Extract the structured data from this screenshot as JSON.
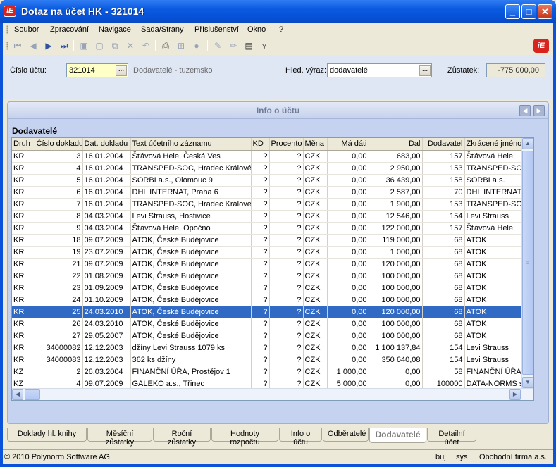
{
  "window": {
    "title": "Dotaz na účet HK - 321014",
    "app_icon_text": "iE",
    "min_label": "_",
    "max_label": "□",
    "close_label": "✕"
  },
  "menu": [
    "Soubor",
    "Zpracování",
    "Navigace",
    "Sada/Strany",
    "Příslušenství",
    "Okno",
    "?"
  ],
  "form": {
    "account_label": "Číslo účtu:",
    "account_value": "321014",
    "account_desc": "Dodavatelé - tuzemsko",
    "search_label": "Hled. výraz:",
    "search_value": "dodavatelé",
    "balance_label": "Zůstatek:",
    "balance_value": "-775 000,00",
    "ellipsis": "..."
  },
  "panel": {
    "title": "Info o účtu",
    "section": "Dodavatelé"
  },
  "table": {
    "columns": [
      "Druh",
      "Číslo dokladu",
      "Dat. dokladu",
      "Text účetního záznamu",
      "KD",
      "Procento",
      "Měna",
      "Má dáti",
      "Dal",
      "Dodavatel",
      "Zkrácené jméno"
    ],
    "rows": [
      [
        "KR",
        "3",
        "16.01.2004",
        "Šťávová Hele, Česká Ves",
        "?",
        "?",
        "CZK",
        "0,00",
        "683,00",
        "157",
        "Šťávová Hele"
      ],
      [
        "KR",
        "4",
        "16.01.2004",
        "TRANSPED-SOC, Hradec Králové",
        "?",
        "?",
        "CZK",
        "0,00",
        "2 950,00",
        "153",
        "TRANSPED-SOC"
      ],
      [
        "KR",
        "5",
        "16.01.2004",
        "SORBI a.s., Olomouc 9",
        "?",
        "?",
        "CZK",
        "0,00",
        "36 439,00",
        "158",
        "SORBI a.s."
      ],
      [
        "KR",
        "6",
        "16.01.2004",
        "DHL INTERNAT, Praha 6",
        "?",
        "?",
        "CZK",
        "0,00",
        "2 587,00",
        "70",
        "DHL INTERNAT"
      ],
      [
        "KR",
        "7",
        "16.01.2004",
        "TRANSPED-SOC, Hradec Králové",
        "?",
        "?",
        "CZK",
        "0,00",
        "1 900,00",
        "153",
        "TRANSPED-SOC"
      ],
      [
        "KR",
        "8",
        "04.03.2004",
        "Levi Strauss, Hostivice",
        "?",
        "?",
        "CZK",
        "0,00",
        "12 546,00",
        "154",
        "Levi Strauss"
      ],
      [
        "KR",
        "9",
        "04.03.2004",
        "Šťávová Hele, Opočno",
        "?",
        "?",
        "CZK",
        "0,00",
        "122 000,00",
        "157",
        "Šťávová Hele"
      ],
      [
        "KR",
        "18",
        "09.07.2009",
        "ATOK, České Budějovice",
        "?",
        "?",
        "CZK",
        "0,00",
        "119 000,00",
        "68",
        "ATOK"
      ],
      [
        "KR",
        "19",
        "23.07.2009",
        "ATOK, České Budějovice",
        "?",
        "?",
        "CZK",
        "0,00",
        "1 000,00",
        "68",
        "ATOK"
      ],
      [
        "KR",
        "21",
        "09.07.2009",
        "ATOK, České Budějovice",
        "?",
        "?",
        "CZK",
        "0,00",
        "120 000,00",
        "68",
        "ATOK"
      ],
      [
        "KR",
        "22",
        "01.08.2009",
        "ATOK, České Budějovice",
        "?",
        "?",
        "CZK",
        "0,00",
        "100 000,00",
        "68",
        "ATOK"
      ],
      [
        "KR",
        "23",
        "01.09.2009",
        "ATOK, České Budějovice",
        "?",
        "?",
        "CZK",
        "0,00",
        "100 000,00",
        "68",
        "ATOK"
      ],
      [
        "KR",
        "24",
        "01.10.2009",
        "ATOK, České Budějovice",
        "?",
        "?",
        "CZK",
        "0,00",
        "100 000,00",
        "68",
        "ATOK"
      ],
      [
        "KR",
        "25",
        "24.03.2010",
        "ATOK, České Budějovice",
        "?",
        "?",
        "CZK",
        "0,00",
        "120 000,00",
        "68",
        "ATOK"
      ],
      [
        "KR",
        "26",
        "24.03.2010",
        "ATOK, České Budějovice",
        "?",
        "?",
        "CZK",
        "0,00",
        "100 000,00",
        "68",
        "ATOK"
      ],
      [
        "KR",
        "27",
        "29.05.2007",
        "ATOK, České Budějovice",
        "?",
        "?",
        "CZK",
        "0,00",
        "100 000,00",
        "68",
        "ATOK"
      ],
      [
        "KR",
        "34000082",
        "12.12.2003",
        "džíny Levi Strauss 1079 ks",
        "?",
        "?",
        "CZK",
        "0,00",
        "1 100 137,84",
        "154",
        "Levi Strauss"
      ],
      [
        "KR",
        "34000083",
        "12.12.2003",
        "362 ks džíny",
        "?",
        "?",
        "CZK",
        "0,00",
        "350 640,08",
        "154",
        "Levi Strauss"
      ],
      [
        "KZ",
        "2",
        "26.03.2004",
        "FINANČNÍ ÚŘA, Prostějov 1",
        "?",
        "?",
        "CZK",
        "1 000,00",
        "0,00",
        "58",
        "FINANČNÍ ÚŘA"
      ],
      [
        "KZ",
        "4",
        "09.07.2009",
        "GALEKO a.s., Třinec",
        "?",
        "?",
        "CZK",
        "5 000,00",
        "0,00",
        "100000",
        "DATA-NORMS s"
      ]
    ],
    "selected_row": 13
  },
  "tabs": [
    "Doklady hl. knihy",
    "Měsíční zůstatky",
    "Roční zůstatky",
    "Hodnoty rozpočtu",
    "Info o účtu",
    "Odběratelé",
    "Dodavatelé",
    "Detailní účet"
  ],
  "active_tab": 6,
  "status": {
    "copyright": "© 2010 Polynorm Software AG",
    "user": "buj",
    "system": "sys",
    "company": "Obchodní firma a.s."
  }
}
